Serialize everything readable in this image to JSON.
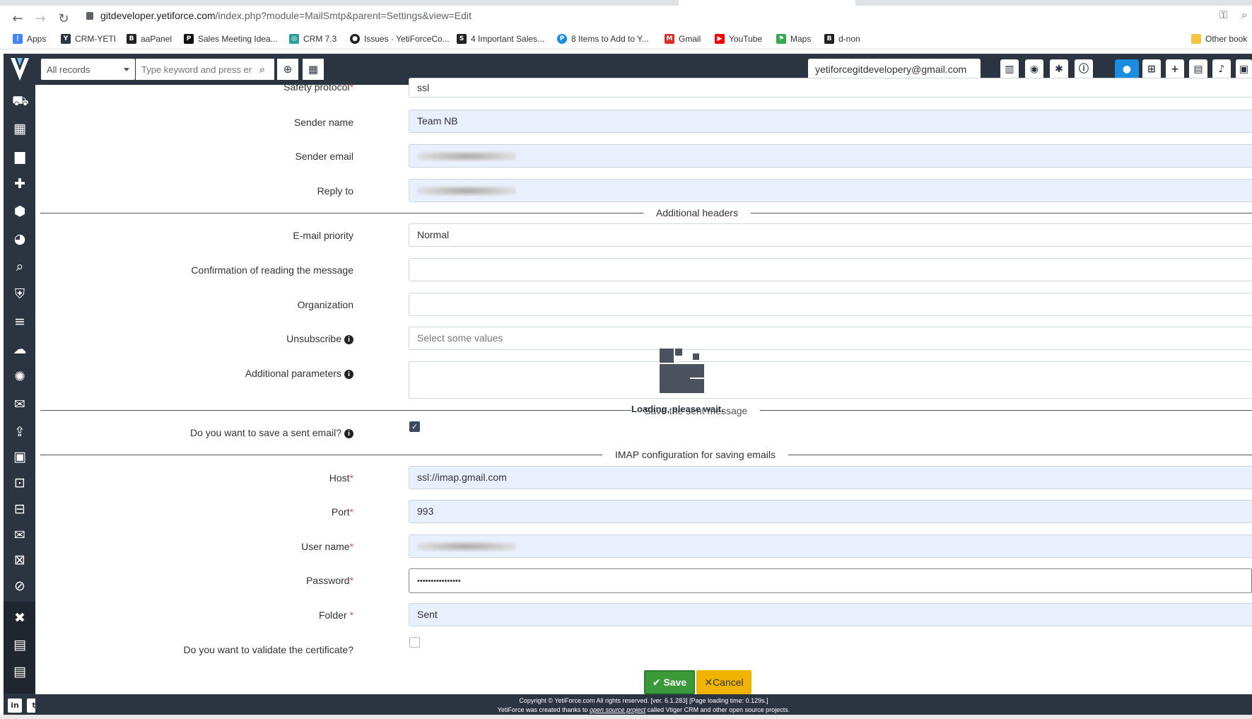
{
  "browser": {
    "url_host": "gitdeveloper.yetiforce.com",
    "url_path": "/index.php?module=MailSmtp&parent=Settings&view=Edit",
    "bookmarks": [
      {
        "label": "Apps",
        "icon": "apps-grid-icon",
        "color": "#4285f4"
      },
      {
        "label": "CRM-YETI",
        "icon": "yetiforce-icon",
        "color": "#2b3441"
      },
      {
        "label": "aaPanel",
        "icon": "bt-icon",
        "color": "#222222"
      },
      {
        "label": "Sales Meeting Idea...",
        "icon": "p-icon",
        "color": "#111111"
      },
      {
        "label": "CRM 7.3",
        "icon": "crm-icon",
        "color": "#2aa198"
      },
      {
        "label": "Issues · YetiForceCo...",
        "icon": "github-icon",
        "color": "#222222"
      },
      {
        "label": "4 Important Sales...",
        "icon": "sh-icon",
        "color": "#222222"
      },
      {
        "label": "8 Items to Add to Y...",
        "icon": "p-circle-icon",
        "color": "#1a8de0"
      },
      {
        "label": "Gmail",
        "icon": "gmail-icon",
        "color": "#d93025"
      },
      {
        "label": "YouTube",
        "icon": "youtube-icon",
        "color": "#ff0000"
      },
      {
        "label": "Maps",
        "icon": "maps-icon",
        "color": "#34a853"
      },
      {
        "label": "d-non",
        "icon": "bt-icon",
        "color": "#222222"
      }
    ],
    "other_bookmarks": "Other book"
  },
  "header": {
    "records_select": "All records",
    "search_placeholder": "Type keyword and press er",
    "user_email": "yetiforcegitdevelopery@gmail.com"
  },
  "form": {
    "safety_protocol": {
      "label": "Safety protocol",
      "value": "ssl"
    },
    "sender_name": {
      "label": "Sender name",
      "value": "Team NB"
    },
    "sender_email": {
      "label": "Sender email"
    },
    "reply_to": {
      "label": "Reply to"
    },
    "additional_headers_title": "Additional headers",
    "email_priority": {
      "label": "E-mail priority",
      "value": "Normal"
    },
    "confirmation": {
      "label": "Confirmation of reading the message",
      "value": ""
    },
    "organization": {
      "label": "Organization",
      "value": ""
    },
    "unsubscribe": {
      "label": "Unsubscribe",
      "placeholder": "Select some values"
    },
    "additional_parameters": {
      "label": "Additional parameters",
      "value": ""
    },
    "save_sent_title": "Save the sent message",
    "save_sent": {
      "label": "Do you want to save a sent email?",
      "checked": true
    },
    "imap_title": "IMAP configuration for saving emails",
    "host": {
      "label": "Host",
      "value": "ssl://imap.gmail.com"
    },
    "port": {
      "label": "Port",
      "value": "993"
    },
    "user_name": {
      "label": "User name"
    },
    "password": {
      "label": "Password",
      "value": "••••••••••••••••"
    },
    "folder": {
      "label": "Folder",
      "value": "Sent"
    },
    "validate_cert": {
      "label": "Do you want to validate the certificate?",
      "checked": false
    }
  },
  "loading_text": "Loading, please wait.",
  "buttons": {
    "save": "Save",
    "cancel": "Cancel"
  },
  "footer": {
    "line1": "Copyright © YetiForce.com All rights reserved. [ver. 6.1.283] [Page loading time: 0.129s.]",
    "line2_pre": "YetiForce was created thanks to ",
    "line2_link": "open source project",
    "line2_post": " called Vtiger CRM and other open source projects."
  },
  "colors": {
    "sidebar": "#2b3441",
    "save": "#3a9a3a",
    "cancel": "#f0b400",
    "accent": "#1a8de0"
  }
}
